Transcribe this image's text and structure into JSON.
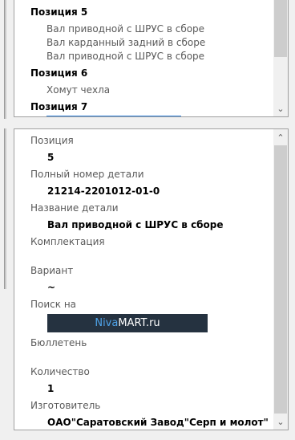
{
  "top_list": {
    "items": [
      {
        "heading": "Позиция 5",
        "parts": [
          "Вал приводной с ШРУС в сборе",
          "Вал карданный задний в сборе",
          "Вал приводной с ШРУС в сборе"
        ]
      },
      {
        "heading": "Позиция 6",
        "parts": [
          "Хомут чехла"
        ]
      },
      {
        "heading": "Позиция 7",
        "parts": []
      }
    ]
  },
  "details": {
    "position_label": "Позиция",
    "position_value": "5",
    "full_number_label": "Полный номер детали",
    "full_number_value": "21214-2201012-01-0",
    "name_label": "Название детали",
    "name_value": "Вал приводной с ШРУС в сборе",
    "kit_label": "Комплектация",
    "kit_value": "",
    "variant_label": "Вариант",
    "variant_value": "~",
    "search_label": "Поиск на",
    "search_logo_part1": "Niva",
    "search_logo_part2": "MART.ru",
    "bulletin_label": "Бюллетень",
    "bulletin_value": "",
    "quantity_label": "Количество",
    "quantity_value": "1",
    "manufacturer_label": "Изготовитель",
    "manufacturer_value": "ОАО\"Саратовский Завод\"Серп и молот\""
  },
  "icons": {
    "scroll_up": "chevron-up-icon",
    "scroll_down": "chevron-down-icon"
  },
  "colors": {
    "logo_bg": "#253240",
    "logo_accent": "#4fa3e8",
    "selection": "#2f7fd8"
  }
}
